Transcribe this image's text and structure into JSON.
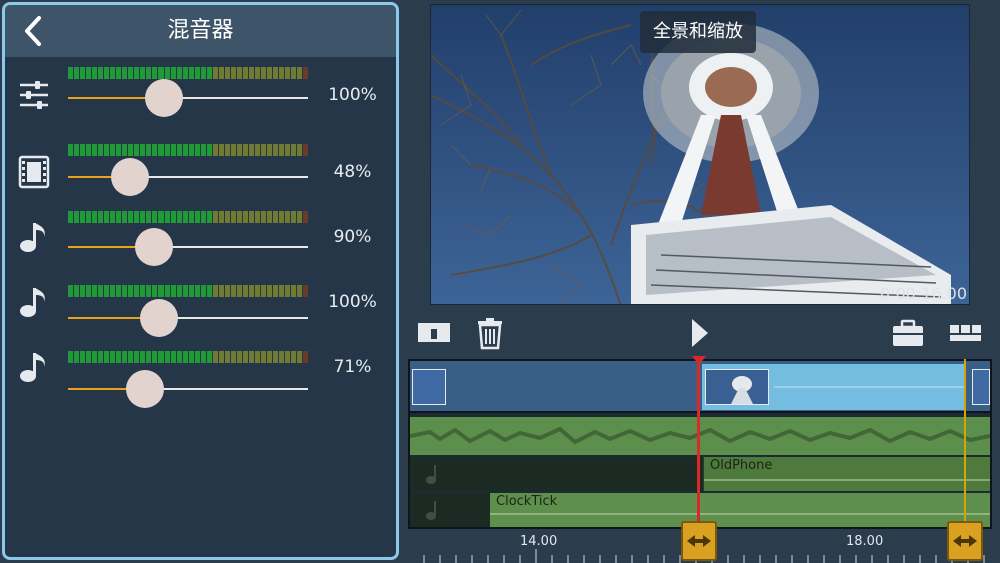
{
  "mixer": {
    "title": "混音器",
    "tracks": [
      {
        "icon": "mixer-sliders-icon",
        "level": 0.4,
        "percent": "100%"
      },
      {
        "icon": "film-icon",
        "level": 0.26,
        "percent": "48%"
      },
      {
        "icon": "music-note-icon",
        "level": 0.36,
        "percent": "90%"
      },
      {
        "icon": "music-note-icon",
        "level": 0.38,
        "percent": "100%"
      },
      {
        "icon": "music-note-icon",
        "level": 0.32,
        "percent": "71%"
      }
    ]
  },
  "preview": {
    "pan_zoom_label": "全景和缩放",
    "timecode": "0:00:16.00"
  },
  "timeline": {
    "clips": {
      "oldphone": "OldPhone",
      "clocktick": "ClockTick"
    },
    "ruler_labels": [
      "14.00",
      "18.00"
    ]
  },
  "colors": {
    "panel_border": "#8cc8ec",
    "slider_fill": "#e9a21a",
    "playhead": "#d92a2a",
    "handle": "#d9a11f"
  }
}
